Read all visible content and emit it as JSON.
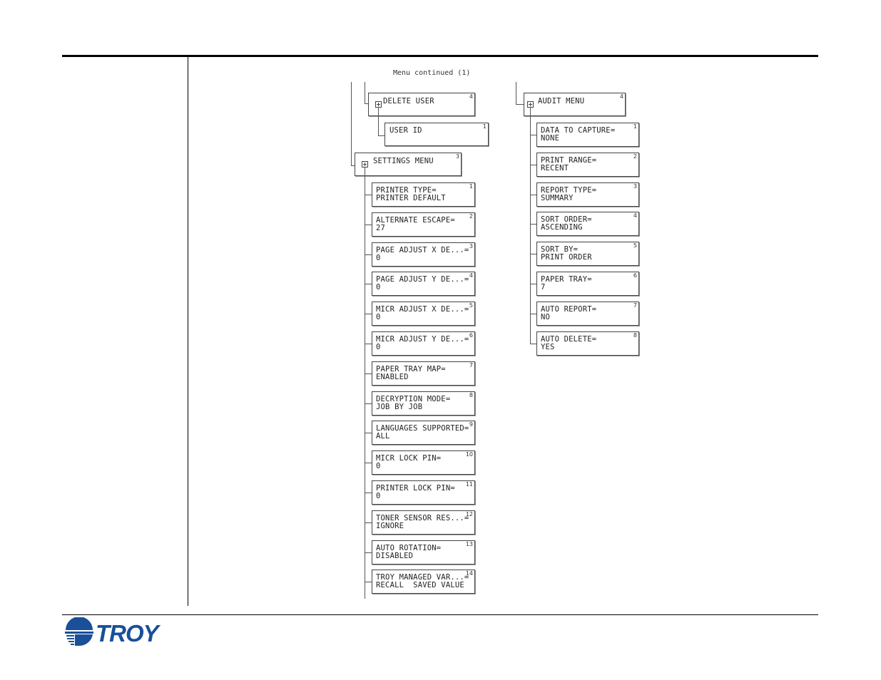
{
  "caption": "Menu continued (1)",
  "delete_user": {
    "label": "DELETE USER",
    "num": "4"
  },
  "user_id": {
    "label": "USER ID",
    "num": "1"
  },
  "settings_menu": {
    "label": "SETTINGS MENU",
    "num": "3",
    "items": [
      {
        "line1": "PRINTER TYPE=",
        "line2": "PRINTER DEFAULT",
        "num": "1"
      },
      {
        "line1": "ALTERNATE ESCAPE=",
        "line2": "27",
        "num": "2"
      },
      {
        "line1": "PAGE ADJUST X DE...=",
        "line2": "0",
        "num": "3"
      },
      {
        "line1": "PAGE ADJUST Y DE...=",
        "line2": "0",
        "num": "4"
      },
      {
        "line1": "MICR ADJUST X DE...=",
        "line2": "0",
        "num": "5"
      },
      {
        "line1": "MICR ADJUST Y DE...=",
        "line2": "0",
        "num": "6"
      },
      {
        "line1": "PAPER TRAY MAP=",
        "line2": "ENABLED",
        "num": "7"
      },
      {
        "line1": "DECRYPTION MODE=",
        "line2": "JOB BY JOB",
        "num": "8"
      },
      {
        "line1": "LANGUAGES SUPPORTED=",
        "line2": "ALL",
        "num": "9"
      },
      {
        "line1": "MICR LOCK PIN=",
        "line2": "0",
        "num": "10"
      },
      {
        "line1": "PRINTER LOCK PIN=",
        "line2": "0",
        "num": "11"
      },
      {
        "line1": "TONER SENSOR RES...=",
        "line2": "IGNORE",
        "num": "12"
      },
      {
        "line1": "AUTO ROTATION=",
        "line2": "DISABLED",
        "num": "13"
      },
      {
        "line1": "TROY MANAGED VAR...=",
        "line2": "RECALL  SAVED VALUE",
        "num": "14"
      }
    ]
  },
  "audit_menu": {
    "label": "AUDIT MENU",
    "num": "4",
    "items": [
      {
        "line1": "DATA TO CAPTURE=",
        "line2": "NONE",
        "num": "1"
      },
      {
        "line1": "PRINT RANGE=",
        "line2": "RECENT",
        "num": "2"
      },
      {
        "line1": "REPORT TYPE=",
        "line2": "SUMMARY",
        "num": "3"
      },
      {
        "line1": "SORT ORDER=",
        "line2": "ASCENDING",
        "num": "4"
      },
      {
        "line1": "SORT BY=",
        "line2": "PRINT ORDER",
        "num": "5"
      },
      {
        "line1": "PAPER TRAY=",
        "line2": "7",
        "num": "6"
      },
      {
        "line1": "AUTO REPORT=",
        "line2": "NO",
        "num": "7"
      },
      {
        "line1": "AUTO DELETE=",
        "line2": "YES",
        "num": "8"
      }
    ]
  },
  "footer": {
    "logo_text": "TROY",
    "brand_color": "#1a4f9a"
  }
}
